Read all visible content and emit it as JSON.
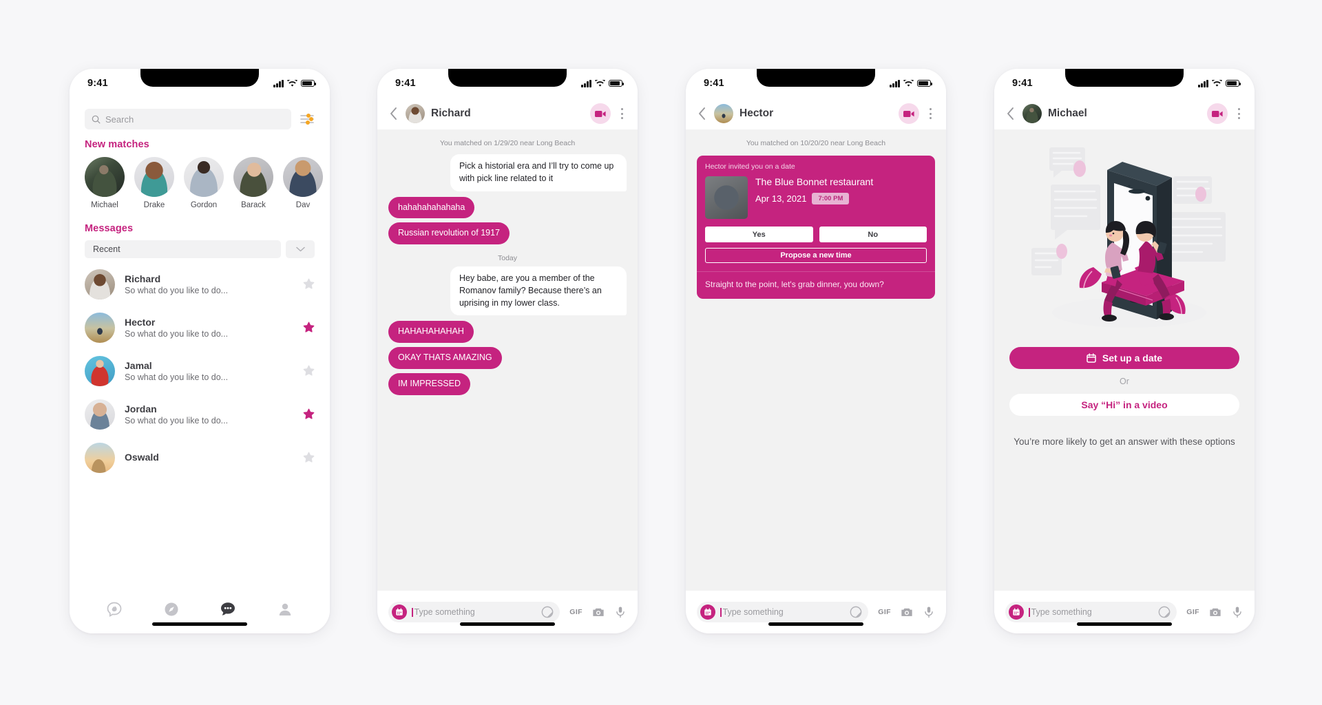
{
  "status_bar": {
    "time": "9:41",
    "signal_icon": "cellular-bars-icon",
    "wifi_icon": "wifi-icon",
    "battery_icon": "battery-icon"
  },
  "phone1": {
    "search": {
      "placeholder": "Search",
      "icon": "search-icon"
    },
    "filter_icon": "filter-sliders-icon",
    "new_matches_title": "New matches",
    "new_matches": [
      {
        "name": "Michael"
      },
      {
        "name": "Drake"
      },
      {
        "name": "Gordon"
      },
      {
        "name": "Barack"
      },
      {
        "name": "Dav"
      }
    ],
    "messages_title": "Messages",
    "sort_value": "Recent",
    "sort_chevron_icon": "chevron-down-icon",
    "conversations": [
      {
        "name": "Richard",
        "preview": "So what do you like to do...",
        "starred": false
      },
      {
        "name": "Hector",
        "preview": "So what do you like to do...",
        "starred": true
      },
      {
        "name": "Jamal",
        "preview": "So what do you like to do...",
        "starred": false
      },
      {
        "name": "Jordan",
        "preview": "So what do you like to do...",
        "starred": true
      },
      {
        "name": "Oswald",
        "preview": "",
        "starred": false
      }
    ],
    "tabs": [
      {
        "icon": "flame-chat-icon",
        "active": false
      },
      {
        "icon": "compass-explore-icon",
        "active": false
      },
      {
        "icon": "messages-bubble-icon",
        "active": true
      },
      {
        "icon": "profile-person-icon",
        "active": false
      }
    ]
  },
  "phone2": {
    "header": {
      "back_icon": "back-chevron-icon",
      "name": "Richard",
      "video_icon": "video-camera-icon",
      "menu_icon": "kebab-menu-icon"
    },
    "match_note": "You matched on 1/29/20 near Long Beach",
    "day_divider": "Today",
    "messages": [
      {
        "from": "them",
        "text": "Pick a historial era and I’ll try to come up with pick line related to it"
      },
      {
        "from": "me",
        "text": "hahahahahahaha"
      },
      {
        "from": "me",
        "text": "Russian revolution of 1917"
      },
      {
        "divider": "Today"
      },
      {
        "from": "them",
        "text": "Hey babe, are you a member of the Romanov family? Because there’s an uprising in my lower class."
      },
      {
        "from": "me",
        "text": "HAHAHAHAHAH"
      },
      {
        "from": "me",
        "text": "OKAY THATS AMAZING"
      },
      {
        "from": "me",
        "text": "IM IMPRESSED"
      }
    ],
    "composer": {
      "calendar_icon": "calendar-icon",
      "placeholder": "Type something",
      "sticker_icon": "sticker-icon",
      "gif_label": "GIF",
      "camera_icon": "camera-icon",
      "mic_icon": "microphone-icon"
    }
  },
  "phone3": {
    "header": {
      "back_icon": "back-chevron-icon",
      "name": "Hector",
      "video_icon": "video-camera-icon",
      "menu_icon": "kebab-menu-icon"
    },
    "match_note": "You matched on 10/20/20 near Long Beach",
    "date_card": {
      "invite_title": "Hector invited you on a date",
      "restaurant": "The Blue Bonnet restaurant",
      "date": "Apr 13, 2021",
      "time": "7:00 PM",
      "yes_label": "Yes",
      "no_label": "No",
      "propose_label": "Propose a new time",
      "message": "Straight to the point, let's grab dinner, you down?"
    },
    "composer": {
      "calendar_icon": "calendar-icon",
      "placeholder": "Type something",
      "sticker_icon": "sticker-icon",
      "gif_label": "GIF",
      "camera_icon": "camera-icon",
      "mic_icon": "microphone-icon"
    }
  },
  "phone4": {
    "header": {
      "back_icon": "back-chevron-icon",
      "name": "Michael",
      "video_icon": "video-camera-icon",
      "menu_icon": "kebab-menu-icon"
    },
    "illustration": "couple-on-phone-illustration",
    "setup_date_label": "Set up a date",
    "setup_date_icon": "calendar-icon",
    "or_label": "Or",
    "video_hi_label": "Say “Hi” in a video",
    "note": "You’re more likely to get an answer with these options",
    "composer": {
      "calendar_icon": "calendar-icon",
      "placeholder": "Type something",
      "sticker_icon": "sticker-icon",
      "gif_label": "GIF",
      "camera_icon": "camera-icon",
      "mic_icon": "microphone-icon"
    }
  },
  "colors": {
    "brand_pink": "#c5237f",
    "light_pink": "#f6d9eb",
    "page_bg": "#f7f7f9",
    "chat_bg": "#f2f2f2",
    "filter_orange": "#f5a623",
    "text_dark": "#3d3d42"
  }
}
